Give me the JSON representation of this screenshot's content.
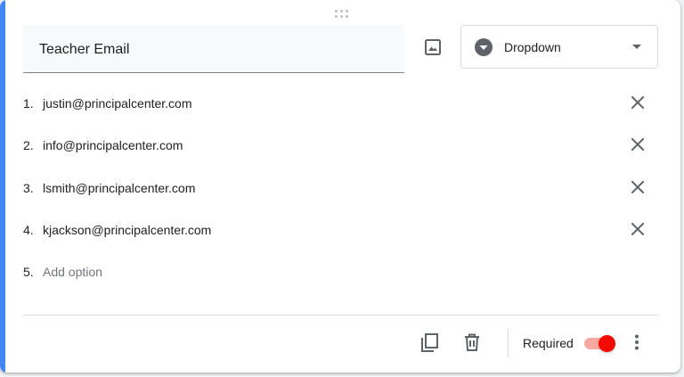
{
  "question": {
    "title": "Teacher Email",
    "type_label": "Dropdown"
  },
  "options": [
    {
      "number": "1.",
      "text": "justin@principalcenter.com"
    },
    {
      "number": "2.",
      "text": "info@principalcenter.com"
    },
    {
      "number": "3.",
      "text": "lsmith@principalcenter.com"
    },
    {
      "number": "4.",
      "text": "kjackson@principalcenter.com"
    }
  ],
  "add_option": {
    "number": "5.",
    "label": "Add option"
  },
  "footer": {
    "required_label": "Required",
    "required_on": true
  },
  "icons": {
    "image": "image-icon",
    "type": "dropdown-circle-icon",
    "remove": "close-icon",
    "duplicate": "copy-icon",
    "delete": "trash-icon",
    "more": "more-vert-icon"
  },
  "colors": {
    "accent": "#4285f4",
    "toggle_on": "#f40b00",
    "toggle_track": "#f7a8a3"
  }
}
